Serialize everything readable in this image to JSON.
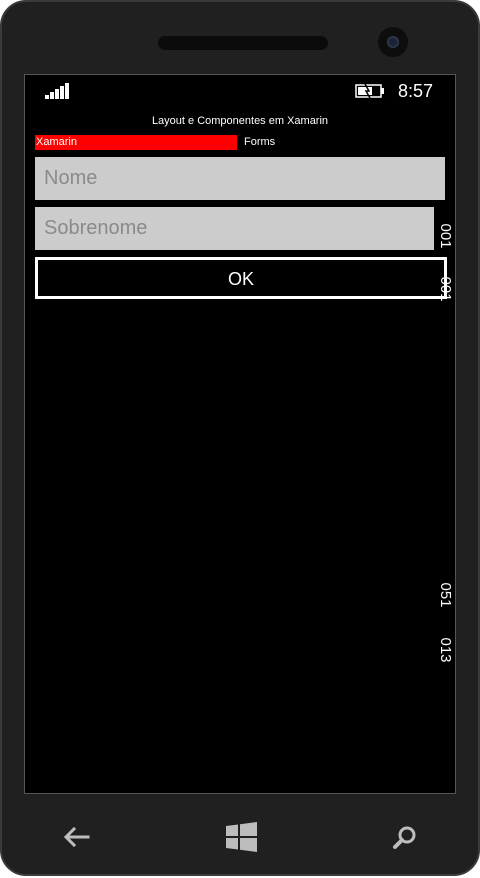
{
  "status_bar": {
    "time": "8:57",
    "signal_bars": 5
  },
  "app": {
    "title": "Layout e Componentes em Xamarin",
    "red_label": "Xamarin",
    "forms_label": "Forms"
  },
  "form": {
    "name_placeholder": "Nome",
    "surname_placeholder": "Sobrenome",
    "ok_label": "OK"
  },
  "side_labels": [
    "001",
    "001",
    "051",
    "013"
  ],
  "nav": {
    "back": "back-icon",
    "start": "windows-start-icon",
    "search": "search-icon"
  },
  "colors": {
    "red_label": "#ff0000",
    "input_bg": "#cccccc",
    "screen_bg": "#000000"
  }
}
